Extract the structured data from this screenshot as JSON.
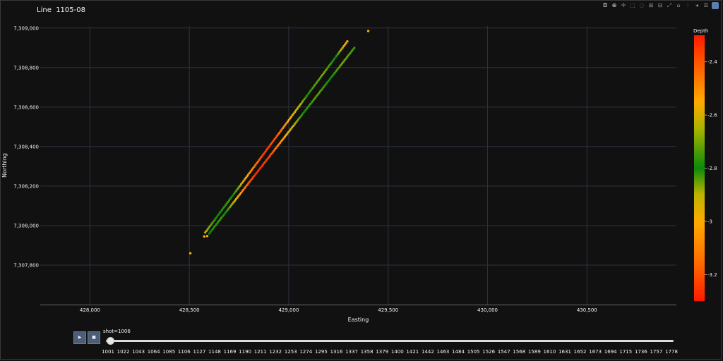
{
  "title": "Line  1105-08",
  "modebar": {
    "buttons": [
      "camera-icon",
      "zoom-icon",
      "pan-icon",
      "box-select-icon",
      "lasso-icon",
      "zoom-in-icon",
      "zoom-out-icon",
      "autoscale-icon",
      "home-icon",
      "spike-lines-icon",
      "hover-closest-icon",
      "hover-compare-icon",
      "plotly-logo-icon"
    ]
  },
  "chart_data": {
    "type": "scatter",
    "title": "Line  1105-08",
    "xlabel": "Easting",
    "ylabel": "Northing",
    "xlim": [
      427750,
      430950
    ],
    "ylim": [
      7307600,
      7309010
    ],
    "x_ticks": [
      "428,000",
      "428,500",
      "429,000",
      "429,500",
      "430,000",
      "430,500"
    ],
    "x_tick_values": [
      428000,
      428500,
      429000,
      429500,
      430000,
      430500
    ],
    "y_ticks": [
      "7,307,800",
      "7,308,000",
      "7,308,200",
      "7,308,400",
      "7,308,600",
      "7,308,800",
      "7,309,000"
    ],
    "y_tick_values": [
      7307800,
      7308000,
      7308200,
      7308400,
      7308600,
      7308800,
      7309000
    ],
    "grid": true,
    "colorbar": {
      "title": "Depth",
      "min": -3.3,
      "max": -2.3,
      "ticks": [
        "-2.4",
        "-2.6",
        "-2.8",
        "-3",
        "-3.2"
      ],
      "tick_values": [
        -2.4,
        -2.6,
        -2.8,
        -3.0,
        -3.2
      ],
      "colors": [
        "#ff1a00",
        "#ff9a00",
        "#f0b400",
        "#0a8a0a",
        "#ffa500",
        "#ff1a00"
      ]
    },
    "lines": [
      {
        "start": [
          428580,
          7307965
        ],
        "end": [
          429295,
          7308933
        ],
        "n": 120,
        "depth_profile": [
          -2.9,
          -2.8,
          -2.75,
          -2.9,
          -3.1,
          -3.25,
          -3.2,
          -3.0,
          -2.9,
          -2.75,
          -2.7,
          -2.8,
          -3.0
        ]
      },
      {
        "start": [
          428600,
          7307960
        ],
        "end": [
          429330,
          7308900
        ],
        "n": 120,
        "depth_profile": [
          -2.8,
          -2.75,
          -2.9,
          -3.15,
          -3.28,
          -3.22,
          -3.05,
          -2.9,
          -2.78,
          -2.72,
          -2.8,
          -2.7,
          -2.75
        ]
      }
    ],
    "extra_points": [
      {
        "x": 428505,
        "y": 7307860,
        "depth": -3.0
      },
      {
        "x": 429400,
        "y": 7308985,
        "depth": -3.0
      },
      {
        "x": 428575,
        "y": 7307945,
        "depth": -3.0
      },
      {
        "x": 428590,
        "y": 7307947,
        "depth": -3.0
      }
    ]
  },
  "slider": {
    "label": "shot=1006",
    "play_label": "▶",
    "stop_label": "■",
    "steps": [
      "1001",
      "1022",
      "1043",
      "1064",
      "1085",
      "1106",
      "1127",
      "1148",
      "1169",
      "1190",
      "1211",
      "1232",
      "1253",
      "1274",
      "1295",
      "1316",
      "1337",
      "1358",
      "1379",
      "1400",
      "1421",
      "1442",
      "1463",
      "1484",
      "1505",
      "1526",
      "1547",
      "1568",
      "1589",
      "1610",
      "1631",
      "1652",
      "1673",
      "1694",
      "1715",
      "1736",
      "1757",
      "1778"
    ]
  }
}
